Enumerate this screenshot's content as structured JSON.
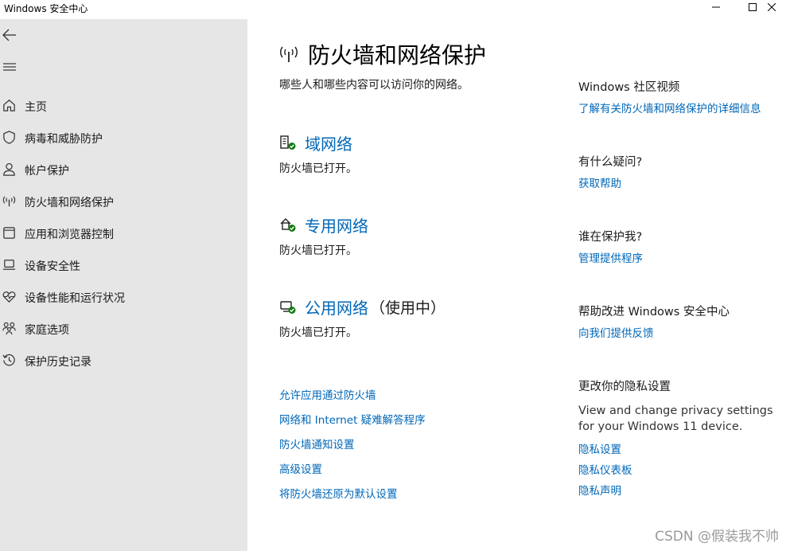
{
  "window": {
    "title": "Windows 安全中心",
    "controls": [
      "minimize-icon",
      "maximize-icon",
      "close-icon"
    ]
  },
  "sidebar": {
    "back_icon": "back-arrow-icon",
    "menu_icon": "hamburger-icon",
    "items": [
      {
        "label": "主页",
        "icon": "home-icon"
      },
      {
        "label": "病毒和威胁防护",
        "icon": "shield-icon"
      },
      {
        "label": "帐户保护",
        "icon": "person-icon"
      },
      {
        "label": "防火墙和网络保护",
        "icon": "antenna-icon"
      },
      {
        "label": "应用和浏览器控制",
        "icon": "app-window-icon"
      },
      {
        "label": "设备安全性",
        "icon": "laptop-icon"
      },
      {
        "label": "设备性能和运行状况",
        "icon": "heart-pulse-icon"
      },
      {
        "label": "家庭选项",
        "icon": "family-icon"
      },
      {
        "label": "保护历史记录",
        "icon": "history-icon"
      }
    ]
  },
  "main": {
    "title": "防火墙和网络保护",
    "description": "哪些人和哪些内容可以访问你的网络。",
    "networks": [
      {
        "name": "域网络",
        "suffix": "",
        "status": "防火墙已打开。",
        "icon": "domain-network-icon"
      },
      {
        "name": "专用网络",
        "suffix": "",
        "status": "防火墙已打开。",
        "icon": "private-network-icon"
      },
      {
        "name": "公用网络",
        "suffix": "（使用中）",
        "status": "防火墙已打开。",
        "icon": "public-network-icon"
      }
    ],
    "links": [
      "允许应用通过防火墙",
      "网络和 Internet 疑难解答程序",
      "防火墙通知设置",
      "高级设置",
      "将防火墙还原为默认设置"
    ]
  },
  "right_panel": {
    "community": {
      "heading": "Windows 社区视频",
      "link": "了解有关防火墙和网络保护的详细信息"
    },
    "questions": {
      "heading": "有什么疑问?",
      "link": "获取帮助"
    },
    "protector": {
      "heading": "谁在保护我?",
      "link": "管理提供程序"
    },
    "improve": {
      "heading": "帮助改进 Windows 安全中心",
      "link": "向我们提供反馈"
    },
    "privacy": {
      "heading": "更改你的隐私设置",
      "text_line1": "View and change privacy settings",
      "text_line2": "for your Windows 11 device.",
      "links": [
        "隐私设置",
        "隐私仪表板",
        "隐私声明"
      ]
    }
  },
  "watermark": "CSDN @假装我不帅",
  "colors": {
    "accent": "#0067b8",
    "sidebar_bg": "#e6e6e6",
    "status_ok": "#107c10"
  }
}
